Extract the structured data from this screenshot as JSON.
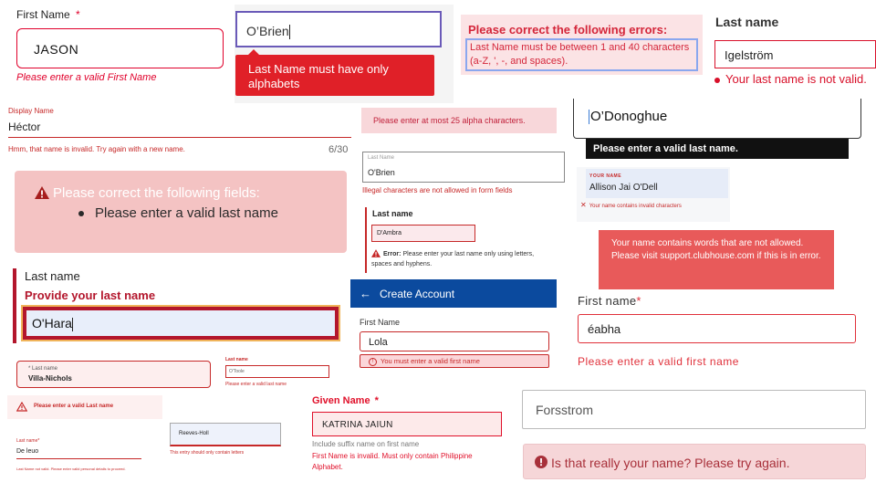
{
  "p1": {
    "label": "First Name",
    "required_mark": "*",
    "value": "JASON",
    "error": "Please enter a valid First Name",
    "accent": "#e0002b"
  },
  "p2": {
    "value": "O’Brien",
    "error": "Last Name must have only alphabets",
    "accent": "#e02028"
  },
  "p3": {
    "title": "Please correct the following errors:",
    "message": "Last Name must be between 1 and 40 characters (a-Z, ', -, and spaces).",
    "accent": "#d4263a"
  },
  "p4": {
    "label": "Last name",
    "value": "Igelström",
    "error": "Your last name is not valid.",
    "accent": "#d8102a"
  },
  "p5": {
    "label": "Display Name",
    "value": "Héctor",
    "error": "Hmm, that name is invalid. Try again with a new name.",
    "counter": "6/30",
    "accent": "#c62828"
  },
  "p6": {
    "message": "Please enter at most 25 alpha characters.",
    "accent": "#c0203a"
  },
  "p7": {
    "value": "O’Donoghue",
    "error": "Please enter a valid last name."
  },
  "p8": {
    "title": "Please correct the following fields:",
    "item": "Please enter a valid last name",
    "warning_icon": "warning-triangle-icon"
  },
  "p9": {
    "label": "Last Name",
    "value": "O'Brien",
    "error": "Illegal characters are not allowed in form fields"
  },
  "p10": {
    "label": "YOUR NAME",
    "value": "Allison Jai O'Dell",
    "error": "Your name contains invalid characters"
  },
  "p11": {
    "label": "Last name",
    "value": "D'Ambra",
    "error_prefix": "Error:",
    "error": "Please enter your last name only using letters, spaces and hyphens."
  },
  "p12": {
    "message": "Your name contains words that are not allowed. Please visit support.clubhouse.com if this is in error.",
    "accent": "#e85a5a"
  },
  "p13": {
    "label": "Last name",
    "error": "Provide your last name",
    "value": "O'Hara",
    "accent": "#b3162c"
  },
  "p14": {
    "title": "Create Account",
    "back_icon": "arrow-left-icon",
    "label": "First Name",
    "value": "Lola",
    "error": "You must enter a valid first name",
    "accent": "#0b4a9e"
  },
  "p15": {
    "label": "First name",
    "required_mark": "*",
    "value": "éabha",
    "error": "Please enter a valid first name",
    "accent": "#e0303a"
  },
  "p16": {
    "label": "* Last name",
    "value": "Villa-Nichols"
  },
  "p17": {
    "label": "Last name",
    "value": "O'Toole",
    "error": "Please enter a valid last name"
  },
  "p18": {
    "message": "Please enter a valid Last name"
  },
  "p19": {
    "label": "Given Name",
    "required_mark": "*",
    "value": "KATRINA JAIUN",
    "hint": "Include suffix name on first name",
    "error": "First Name is invalid. Must only contain Philippine Alphabet.",
    "accent": "#e0102a"
  },
  "p20": {
    "value": "Forsstrom"
  },
  "p21": {
    "label": "Last name*",
    "value": "De leuo",
    "error": "Last Name not valid. Please enter valid personal details to proceed."
  },
  "p22": {
    "value": "Reeves-Holl",
    "error": "This entry should only contain letters"
  },
  "p23": {
    "message": "Is that really your name? Please try again.",
    "accent": "#a8303a"
  }
}
